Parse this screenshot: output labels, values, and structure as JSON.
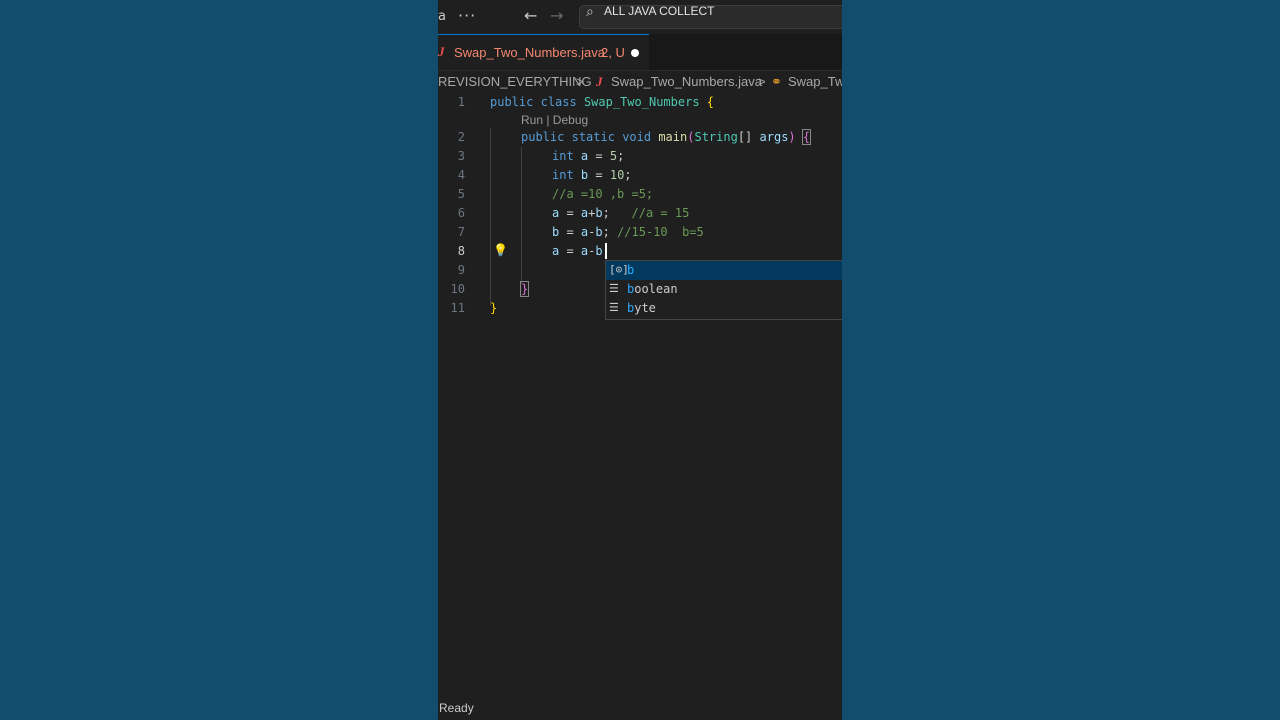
{
  "titlebar": {
    "cut_label": "a",
    "more_icon": "ellipsis-icon",
    "back_icon": "arrow-left-icon",
    "forward_icon": "arrow-right-icon",
    "search_icon": "search-icon",
    "command_center_text": "ALL JAVA COLLECT"
  },
  "tab": {
    "file_icon": "J",
    "filename": "Swap_Two_Numbers.java",
    "badge": "2, U",
    "modified_indicator": "dirty-dot-icon"
  },
  "breadcrumb": {
    "folder": "REVISION_EVERYTHING",
    "sep1": ">",
    "file_icon": "J",
    "file": "Swap_Two_Numbers.java",
    "sep2": ">",
    "symbol_icon": "class-symbol-icon",
    "symbol": "Swap_Tw"
  },
  "editor": {
    "codelens": "Run | Debug",
    "active_line": 8,
    "lines": [
      {
        "n": "1",
        "text": "public class Swap_Two_Numbers {"
      },
      {
        "n": "2",
        "text": "public static void main(String[] args) {"
      },
      {
        "n": "3",
        "text": "int a = 5;"
      },
      {
        "n": "4",
        "text": "int b = 10;"
      },
      {
        "n": "5",
        "text": "//a =10 ,b =5;"
      },
      {
        "n": "6",
        "text": "a = a+b;   //a = 15"
      },
      {
        "n": "7",
        "text": "b = a-b; //15-10  b=5"
      },
      {
        "n": "8",
        "text": "a = a-b"
      },
      {
        "n": "9",
        "text": ""
      },
      {
        "n": "10",
        "text": "}"
      },
      {
        "n": "11",
        "text": "}"
      }
    ]
  },
  "suggest": {
    "items": [
      {
        "icon": "variable-icon",
        "match": "b",
        "rest": ""
      },
      {
        "icon": "keyword-icon",
        "match": "b",
        "rest": "oolean"
      },
      {
        "icon": "keyword-icon",
        "match": "b",
        "rest": "yte"
      }
    ]
  },
  "status": {
    "text": "Ready"
  },
  "colors": {
    "background": "#134d6d",
    "editor_bg": "#1f1f1f",
    "accent": "#0078d4",
    "error_tab": "#f48771"
  }
}
